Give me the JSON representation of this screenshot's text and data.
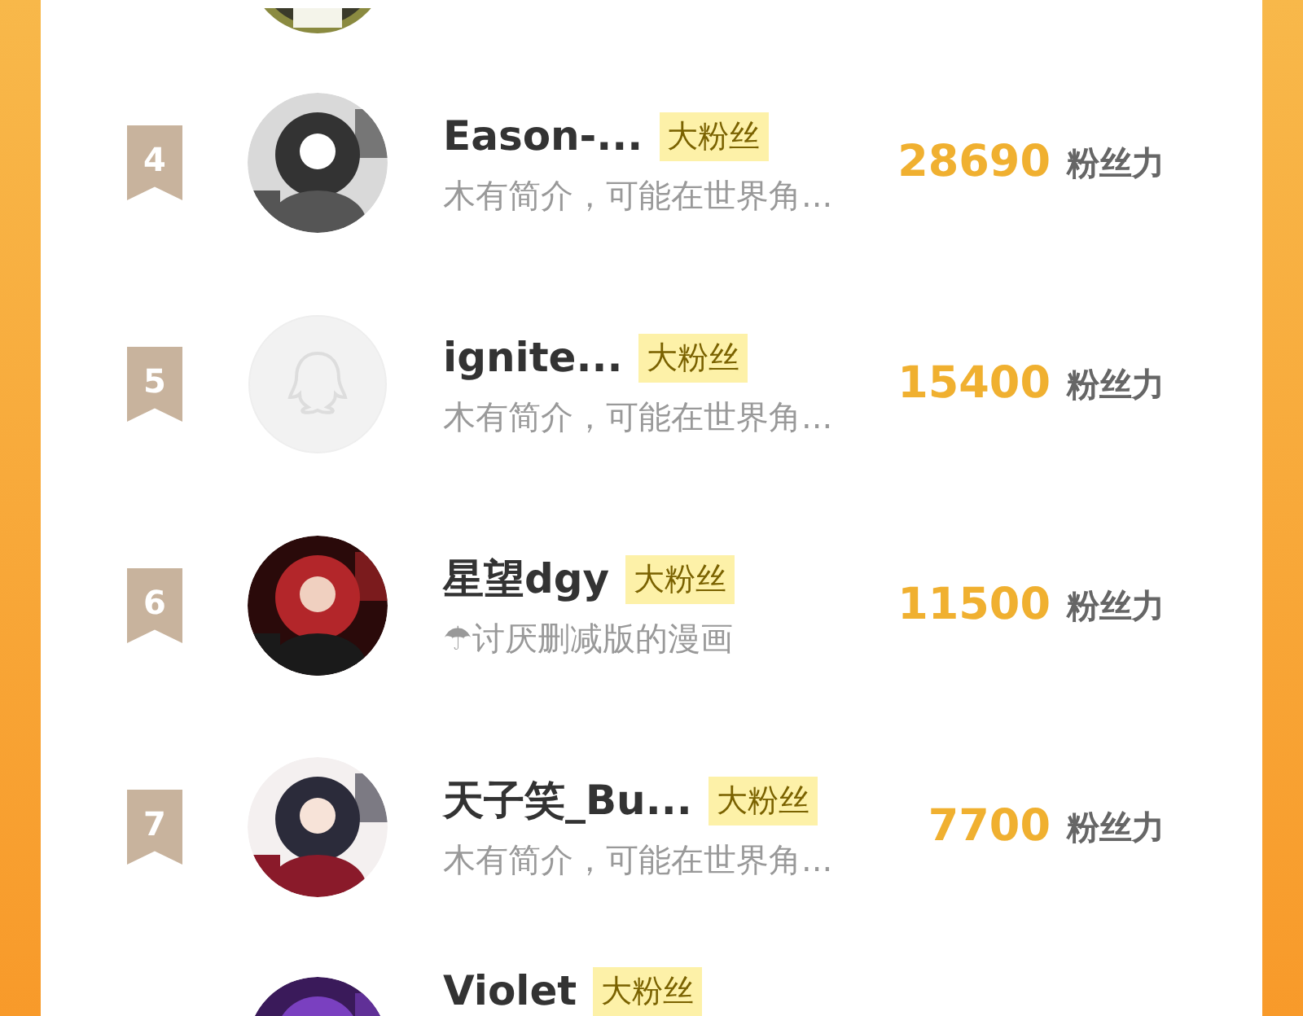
{
  "rows": [
    {
      "rank": "4",
      "name": "Eason-...",
      "badge": "大粉丝",
      "bio": "木有简介，可能在世界角...",
      "score": "28690",
      "unit": "粉丝力"
    },
    {
      "rank": "5",
      "avatar": {
        "kind": "default"
      },
      "name": "ignite...",
      "badge": "大粉丝",
      "bio": "木有简介，可能在世界角...",
      "score": "15400",
      "unit": "粉丝力"
    },
    {
      "rank": "6",
      "name": "星望dgy",
      "badge": "大粉丝",
      "bio": "☂讨厌删减版的漫画",
      "score": "11500",
      "unit": "粉丝力"
    },
    {
      "rank": "7",
      "name": "天子笑_Bu...",
      "badge": "大粉丝",
      "bio": "木有简介，可能在世界角...",
      "score": "7700",
      "unit": "粉丝力"
    }
  ],
  "partial_row": {
    "name": "Violet",
    "badge": "大粉丝"
  }
}
